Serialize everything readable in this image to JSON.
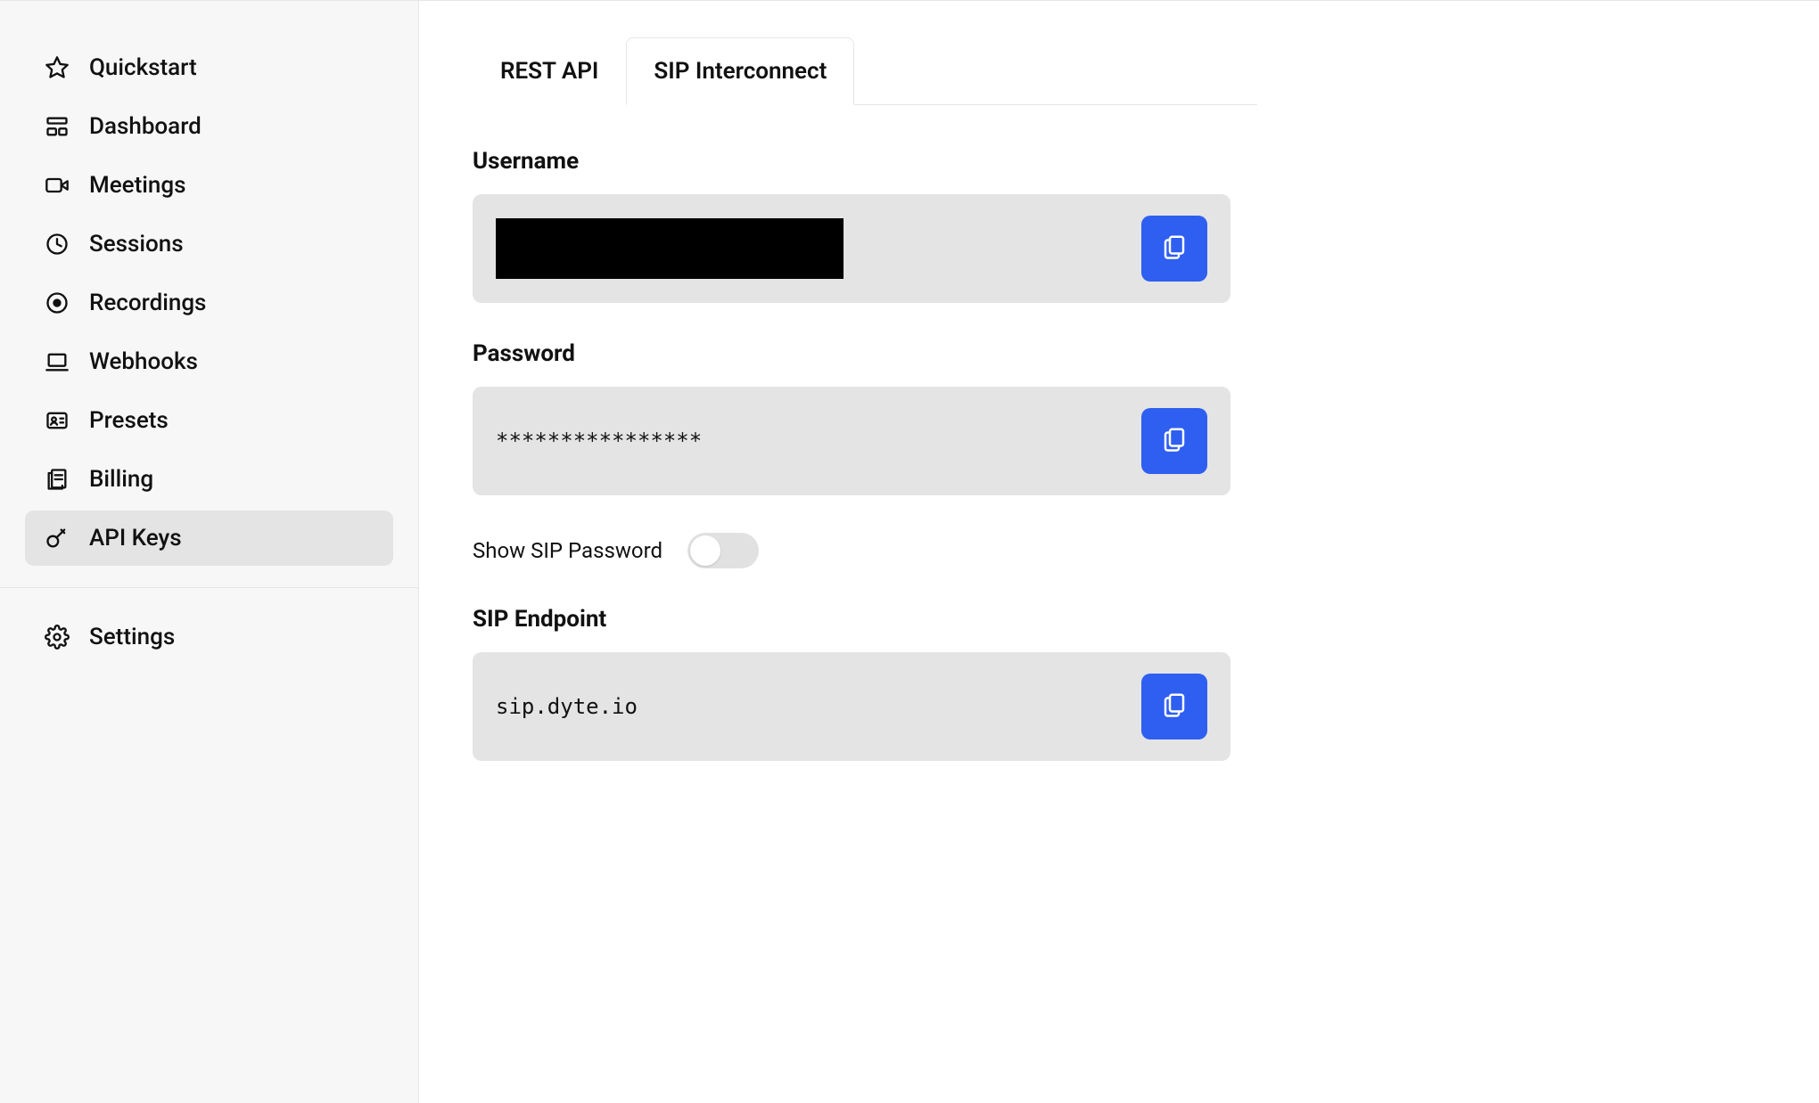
{
  "sidebar": {
    "items": [
      {
        "id": "quickstart",
        "label": "Quickstart",
        "icon": "star-icon"
      },
      {
        "id": "dashboard",
        "label": "Dashboard",
        "icon": "grid-icon"
      },
      {
        "id": "meetings",
        "label": "Meetings",
        "icon": "video-icon"
      },
      {
        "id": "sessions",
        "label": "Sessions",
        "icon": "clock-icon"
      },
      {
        "id": "recordings",
        "label": "Recordings",
        "icon": "record-icon"
      },
      {
        "id": "webhooks",
        "label": "Webhooks",
        "icon": "laptop-icon"
      },
      {
        "id": "presets",
        "label": "Presets",
        "icon": "id-icon"
      },
      {
        "id": "billing",
        "label": "Billing",
        "icon": "billing-icon"
      },
      {
        "id": "api-keys",
        "label": "API Keys",
        "icon": "key-icon",
        "active": true
      }
    ],
    "footer": [
      {
        "id": "settings",
        "label": "Settings",
        "icon": "gear-icon"
      }
    ]
  },
  "tabs": [
    {
      "id": "rest-api",
      "label": "REST API",
      "active": false
    },
    {
      "id": "sip-interconnect",
      "label": "SIP Interconnect",
      "active": true
    }
  ],
  "fields": {
    "username_label": "Username",
    "username_value": "",
    "username_redacted": true,
    "password_label": "Password",
    "password_value": "****************",
    "show_password_label": "Show SIP Password",
    "show_password_on": false,
    "endpoint_label": "SIP Endpoint",
    "endpoint_value": "sip.dyte.io"
  }
}
